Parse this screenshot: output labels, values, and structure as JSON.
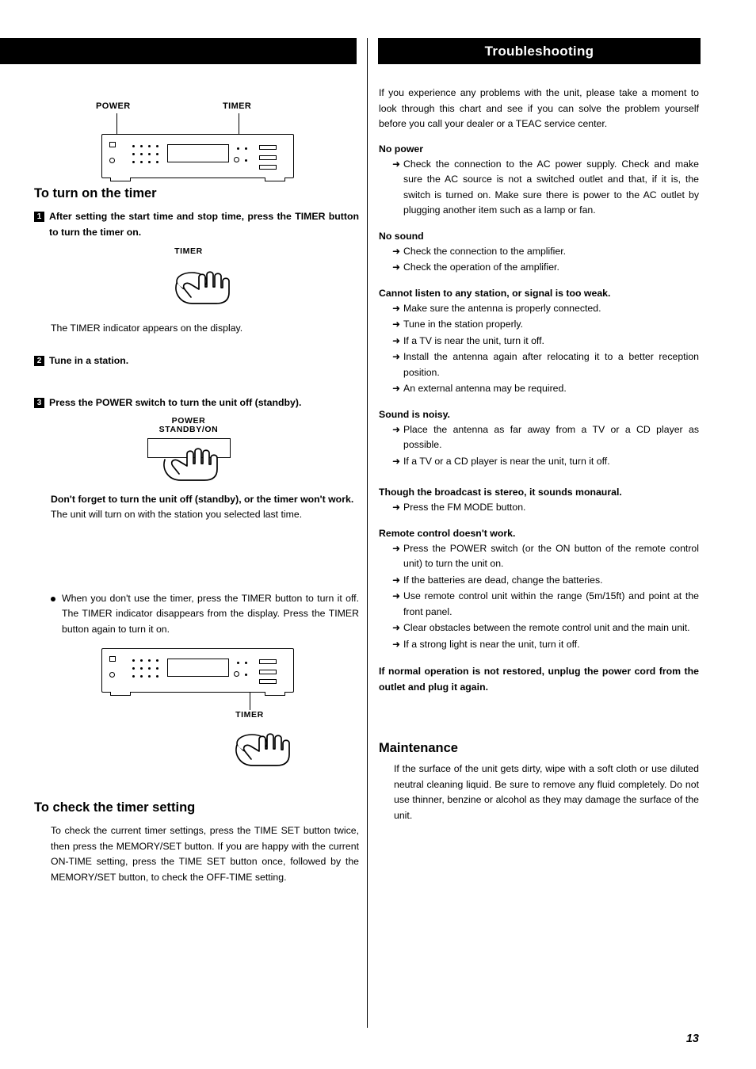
{
  "header": {
    "right_title": "Troubleshooting"
  },
  "page_number": "13",
  "left": {
    "diagram_top": {
      "label_power": "POWER",
      "label_timer": "TIMER"
    },
    "section1_title": "To turn on the timer",
    "step1": {
      "num": "1",
      "text": "After setting the start time and stop time, press the TIMER button to turn the timer on."
    },
    "step1_button_label": "TIMER",
    "step1_note": "The TIMER indicator appears on the display.",
    "step2": {
      "num": "2",
      "text": "Tune in a station."
    },
    "step3": {
      "num": "3",
      "text": "Press the POWER switch to turn the unit off (standby)."
    },
    "step3_button_label_line1": "POWER",
    "step3_button_label_line2": "STANDBY/ON",
    "warning_bold": "Don't forget to turn the unit off (standby), or the timer won't work.",
    "warning_text": "The unit will turn on with the station you selected last time.",
    "bullet_note": "When you don't use the timer, press the TIMER button to turn it off. The TIMER indicator disappears from the display. Press the TIMER button again to turn it on.",
    "diagram_bottom_label": "TIMER",
    "section2_title": "To check the timer setting",
    "section2_text": "To check the current timer settings, press the TIME SET button twice, then press the MEMORY/SET button. If you are happy with the current ON-TIME setting, press the TIME SET button once, followed by the MEMORY/SET button, to check the OFF-TIME setting."
  },
  "right": {
    "intro": "If you experience any problems with the unit, please take a moment to look through this chart and see if you can solve the problem yourself before you call your dealer or a TEAC service center.",
    "arrow_glyph": "➜",
    "groups": [
      {
        "heading": "No power",
        "items": [
          "Check the connection to the AC power supply. Check and make sure the AC source is not a switched outlet and that, if it is, the switch is turned on. Make sure there is power to the AC outlet by plugging another item such as a lamp or fan."
        ]
      },
      {
        "heading": "No sound",
        "items": [
          "Check the connection to the amplifier.",
          "Check the operation of the amplifier."
        ]
      },
      {
        "heading": "Cannot listen to any station, or signal is too weak.",
        "items": [
          "Make sure the antenna is properly connected.",
          "Tune in the station properly.",
          "If a TV is near the unit, turn it off.",
          "Install the antenna again after relocating it to a better reception position.",
          "An external antenna may be required."
        ]
      },
      {
        "heading": "Sound is noisy.",
        "items": [
          "Place the antenna as far away from a TV or a CD player as possible.",
          "If a TV or a CD player is near the unit, turn it off."
        ]
      },
      {
        "heading": "Though the broadcast is stereo, it sounds monaural.",
        "items": [
          "Press the FM MODE button."
        ]
      },
      {
        "heading": "Remote control doesn't work.",
        "items": [
          "Press the POWER switch (or the ON button of the remote control unit) to turn the unit on.",
          "If the batteries are dead, change the batteries.",
          "Use remote control unit within the range (5m/15ft) and point at the front panel.",
          "Clear obstacles between the remote control unit and the main unit.",
          "If a strong light is near the unit, turn it off."
        ]
      }
    ],
    "closing_note": "If normal operation is not restored, unplug the power cord from the outlet and plug it again.",
    "maintenance_title": "Maintenance",
    "maintenance_text": "If the surface of the unit gets dirty, wipe with a soft cloth or use diluted neutral cleaning liquid. Be sure to remove any fluid completely. Do not use thinner, benzine or alcohol as they may damage the surface of the unit."
  }
}
